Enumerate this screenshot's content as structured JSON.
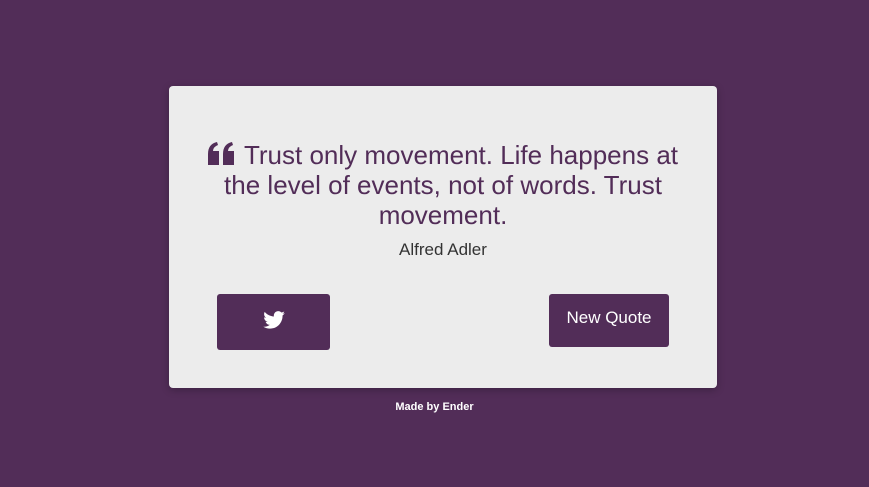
{
  "quote": {
    "text": "Trust only movement. Life happens at the level of events, not of words. Trust movement.",
    "author": "Alfred Adler",
    "icon": "quote-left-icon"
  },
  "buttons": {
    "tweet_icon": "twitter-icon",
    "new_quote_label": "New Quote"
  },
  "footer": {
    "text": "Made by Ender"
  },
  "colors": {
    "background": "#522d58",
    "card": "#ececec",
    "accent": "#522d58"
  }
}
